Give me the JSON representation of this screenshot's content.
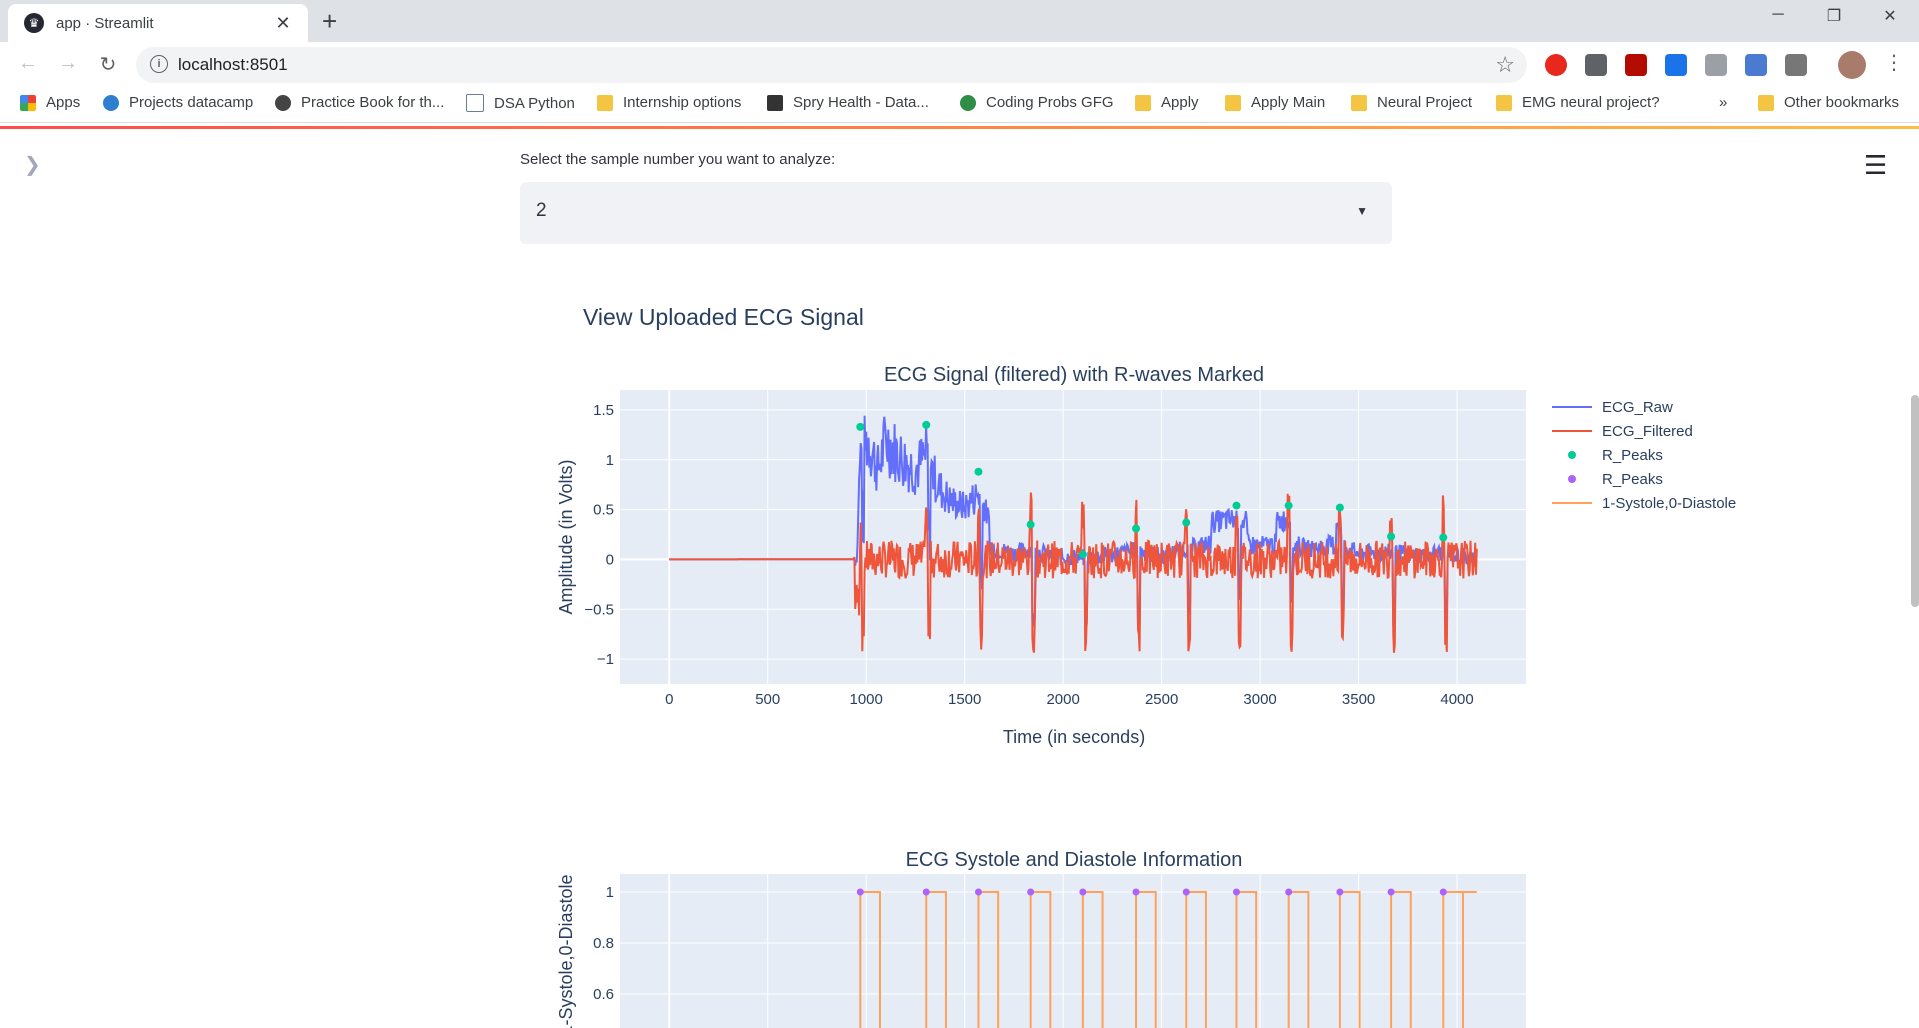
{
  "browser": {
    "tab_title": "app · Streamlit",
    "url": "localhost:8501",
    "bookmarks": [
      "Apps",
      "Projects datacamp",
      "Practice Book for th...",
      "DSA Python",
      "Internship options",
      "Spry Health - Data...",
      "Coding Probs GFG",
      "Apply",
      "Apply Main",
      "Neural Project",
      "EMG neural project?",
      "Other bookmarks"
    ],
    "more": "»"
  },
  "app": {
    "select_label": "Select the sample number you want to analyze:",
    "select_value": "2",
    "section_title": "View Uploaded ECG Signal"
  },
  "chart_data": [
    {
      "type": "line",
      "title": "ECG Signal (filtered) with R-waves Marked",
      "xlabel": "Time (in seconds)",
      "ylabel": "Amplitude (in Volts)",
      "xlim": [
        -250,
        4350
      ],
      "ylim": [
        -1.25,
        1.7
      ],
      "xticks": [
        0,
        500,
        1000,
        1500,
        2000,
        2500,
        3000,
        3500,
        4000
      ],
      "yticks": [
        1.5,
        1,
        0.5,
        0,
        -0.5,
        -1
      ],
      "ytick_labels": [
        "1.5",
        "1",
        "0.5",
        "0",
        "−0.5",
        "−1"
      ],
      "legend": [
        "ECG_Raw",
        "ECG_Filtered",
        "R_Peaks",
        "R_Peaks",
        "1-Systole,0-Diastole"
      ],
      "legend_placement": "right",
      "colors": {
        "raw": "#636efa",
        "filtered": "#ef553b",
        "rpeaks1": "#00cc96",
        "rpeaks2": "#ab63fa",
        "systole": "#ffa15a"
      },
      "r_peaks": [
        {
          "x": 970,
          "y": 1.33
        },
        {
          "x": 1305,
          "y": 1.35
        },
        {
          "x": 1570,
          "y": 0.88
        },
        {
          "x": 1835,
          "y": 0.35
        },
        {
          "x": 2100,
          "y": 0.05
        },
        {
          "x": 2370,
          "y": 0.31
        },
        {
          "x": 2625,
          "y": 0.37
        },
        {
          "x": 2880,
          "y": 0.54
        },
        {
          "x": 3145,
          "y": 0.54
        },
        {
          "x": 3405,
          "y": 0.52
        },
        {
          "x": 3665,
          "y": 0.23
        },
        {
          "x": 3930,
          "y": 0.22
        }
      ],
      "raw_envelope": [
        [
          0,
          0
        ],
        [
          950,
          0.02
        ],
        [
          970,
          1.4
        ],
        [
          1010,
          1.6
        ],
        [
          1060,
          1.2
        ],
        [
          1100,
          1.6
        ],
        [
          1180,
          1.35
        ],
        [
          1250,
          1.2
        ],
        [
          1305,
          1.4
        ],
        [
          1360,
          1.0
        ],
        [
          1420,
          0.8
        ],
        [
          1500,
          0.7
        ],
        [
          1570,
          0.88
        ],
        [
          1650,
          0.35
        ],
        [
          1750,
          0.2
        ],
        [
          1835,
          0.35
        ],
        [
          1950,
          0.1
        ],
        [
          2100,
          0.05
        ],
        [
          2250,
          0.15
        ],
        [
          2370,
          0.31
        ],
        [
          2500,
          0.1
        ],
        [
          2625,
          0.37
        ],
        [
          2750,
          0.5
        ],
        [
          2880,
          0.54
        ],
        [
          3000,
          0.45
        ],
        [
          3145,
          0.54
        ],
        [
          3250,
          0.35
        ],
        [
          3405,
          0.52
        ],
        [
          3500,
          0.2
        ],
        [
          3665,
          0.23
        ],
        [
          3800,
          0.15
        ],
        [
          3930,
          0.22
        ],
        [
          4100,
          0.0
        ]
      ]
    },
    {
      "type": "line",
      "title": "ECG Systole and Diastole Information",
      "ylabel": "1-Systole,0-Diastole",
      "xlim": [
        -250,
        4350
      ],
      "yticks": [
        1,
        0.8,
        0.6
      ],
      "systole_starts": [
        970,
        1305,
        1570,
        1835,
        2100,
        2370,
        2625,
        2880,
        3145,
        3405,
        3665,
        3930
      ],
      "systole_width": 100,
      "peak_y": 1
    }
  ]
}
